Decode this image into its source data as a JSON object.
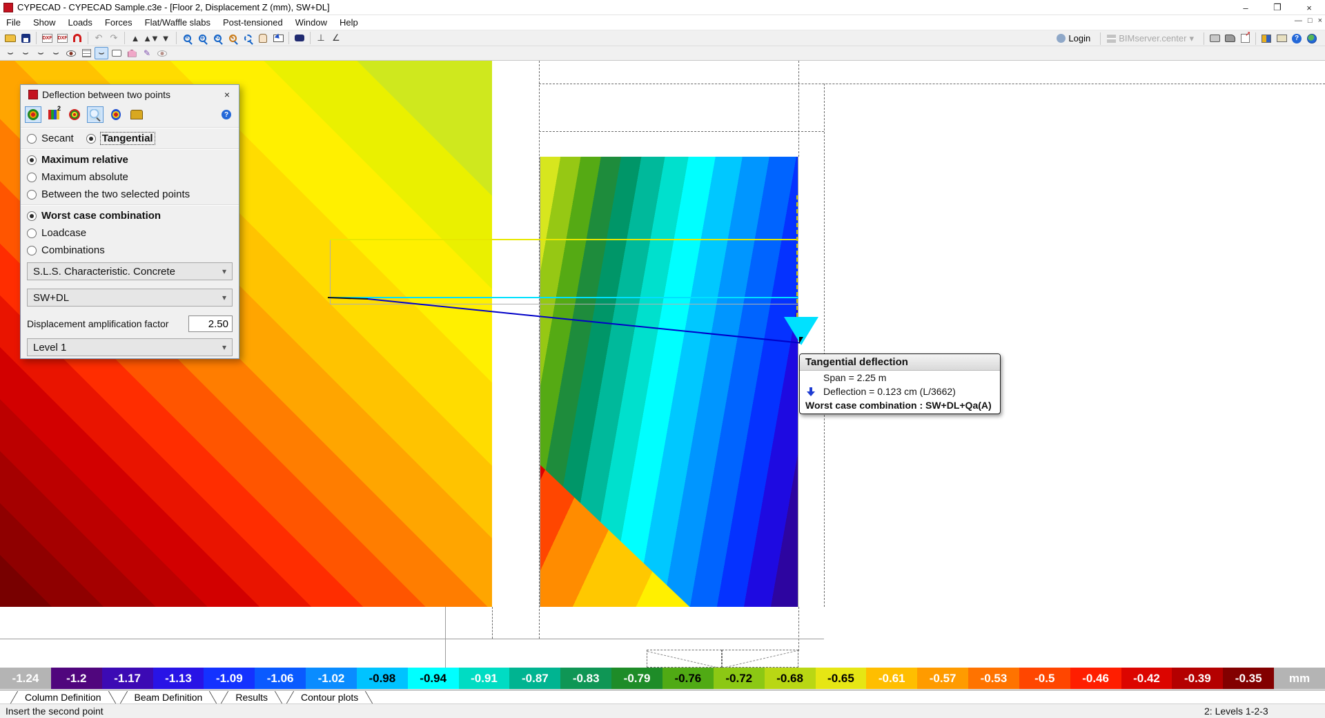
{
  "window": {
    "title": "CYPECAD - CYPECAD Sample.c3e - [Floor 2, Displacement Z (mm), SW+DL]",
    "minimize": "–",
    "restore": "❐",
    "close": "×"
  },
  "menu": {
    "items": [
      "File",
      "Show",
      "Loads",
      "Forces",
      "Flat/Waffle slabs",
      "Post-tensioned",
      "Window",
      "Help"
    ]
  },
  "icons": {
    "up": "▲",
    "down": "▼",
    "undo": "↶",
    "redo": "↷",
    "perp": "⊥",
    "angle": "∠",
    "valley": "⌣",
    "caret": "▾",
    "question": "?",
    "x2": "×2",
    "zoom_r": "R",
    "pen": "✎"
  },
  "toolbar_right": {
    "login": "Login",
    "bimserver": "BIMserver.center"
  },
  "dialog": {
    "title": "Deflection between two points",
    "deflection_type": [
      {
        "label": "Secant",
        "selected": false
      },
      {
        "label": "Tangential",
        "selected": true
      }
    ],
    "mode_options": [
      {
        "label": "Maximum relative",
        "selected": true
      },
      {
        "label": "Maximum absolute",
        "selected": false
      },
      {
        "label": "Between the two selected points",
        "selected": false
      }
    ],
    "case_options": [
      {
        "label": "Worst case combination",
        "selected": true
      },
      {
        "label": "Loadcase",
        "selected": false
      },
      {
        "label": "Combinations",
        "selected": false
      }
    ],
    "combo_group": "S.L.S. Characteristic. Concrete",
    "combo_loadcase": "SW+DL",
    "amplification_label": "Displacement amplification factor",
    "amplification_value": "2.50",
    "level": "Level 1"
  },
  "tooltip": {
    "title": "Tangential deflection",
    "span": "Span = 2.25 m",
    "deflection": "Deflection = 0.123 cm (L/3662)",
    "combination": "Worst case combination : SW+DL+Qa(A)"
  },
  "scale": {
    "unit": "mm",
    "entries": [
      {
        "value": "-1.24",
        "color": "#b4b4b4",
        "text_color": "#ffffff"
      },
      {
        "value": "-1.2",
        "color": "#50067d",
        "text_color": "#ffffff"
      },
      {
        "value": "-1.17",
        "color": "#3c0ab4",
        "text_color": "#ffffff"
      },
      {
        "value": "-1.13",
        "color": "#2814e6",
        "text_color": "#ffffff"
      },
      {
        "value": "-1.09",
        "color": "#1432ff",
        "text_color": "#ffffff"
      },
      {
        "value": "-1.06",
        "color": "#0a5aff",
        "text_color": "#ffffff"
      },
      {
        "value": "-1.02",
        "color": "#0a8cff",
        "text_color": "#ffffff"
      },
      {
        "value": "-0.98",
        "color": "#00c3ff",
        "text_color": "#000000"
      },
      {
        "value": "-0.94",
        "color": "#00ffff",
        "text_color": "#000000"
      },
      {
        "value": "-0.91",
        "color": "#00dcc3",
        "text_color": "#ffffff"
      },
      {
        "value": "-0.87",
        "color": "#00b491",
        "text_color": "#ffffff"
      },
      {
        "value": "-0.83",
        "color": "#0f9655",
        "text_color": "#ffffff"
      },
      {
        "value": "-0.79",
        "color": "#1e8c28",
        "text_color": "#ffffff"
      },
      {
        "value": "-0.76",
        "color": "#50aa14",
        "text_color": "#000000"
      },
      {
        "value": "-0.72",
        "color": "#8cc814",
        "text_color": "#000000"
      },
      {
        "value": "-0.68",
        "color": "#b9d714",
        "text_color": "#000000"
      },
      {
        "value": "-0.65",
        "color": "#e6e614",
        "text_color": "#000000"
      },
      {
        "value": "-0.61",
        "color": "#ffbe00",
        "text_color": "#ffffff"
      },
      {
        "value": "-0.57",
        "color": "#ff9b00",
        "text_color": "#ffffff"
      },
      {
        "value": "-0.53",
        "color": "#ff7300",
        "text_color": "#ffffff"
      },
      {
        "value": "-0.5",
        "color": "#ff4600",
        "text_color": "#ffffff"
      },
      {
        "value": "-0.46",
        "color": "#ff1e00",
        "text_color": "#ffffff"
      },
      {
        "value": "-0.42",
        "color": "#dc0500",
        "text_color": "#ffffff"
      },
      {
        "value": "-0.39",
        "color": "#b40000",
        "text_color": "#ffffff"
      },
      {
        "value": "-0.35",
        "color": "#820000",
        "text_color": "#ffffff"
      },
      {
        "value": "mm",
        "color": "#b4b4b4",
        "text_color": "#ffffff"
      }
    ]
  },
  "tabs": [
    "Column Definition",
    "Beam Definition",
    "Results",
    "Contour plots"
  ],
  "status": {
    "left": "Insert the second point",
    "right": "2: Levels 1-2-3"
  }
}
